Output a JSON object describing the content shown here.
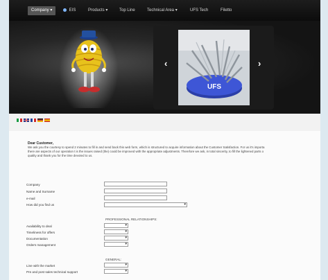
{
  "nav": {
    "items": [
      {
        "label": "Company",
        "caret": "▾",
        "active": true
      },
      {
        "label": "EIS",
        "active": false
      },
      {
        "label": "Products",
        "caret": "▾",
        "active": false
      },
      {
        "label": "Top Line",
        "active": false
      },
      {
        "label": "Technical Area",
        "caret": "▾",
        "active": false
      },
      {
        "label": "UFS Tech",
        "active": false
      },
      {
        "label": "Filetto",
        "active": false
      }
    ]
  },
  "slider": {
    "prev_glyph": "‹",
    "next_glyph": "›",
    "prev_icon": "chevron-left-icon",
    "next_icon": "chevron-right-icon"
  },
  "flags": [
    "italy-flag-icon",
    "uk-flag-icon",
    "france-flag-icon",
    "germany-flag-icon",
    "spain-flag-icon"
  ],
  "survey": {
    "greeting": "Dear Customer,",
    "intro_lines": [
      "We ask you the courtesy to spend 2 minutes to fill in and send back this web form, which is structured to acquire information about the Customer Satisfaction. For us it's importa",
      "there are aspects of our operation t is the issues raised (the) could be improved with the appropriate adjustments. Therefore we ask, in total sincerity, to fill the lightened parts o",
      "quality and thank you for the time devoted to us."
    ],
    "fields": [
      {
        "label": "Company",
        "value": ""
      },
      {
        "label": "Name and Surname",
        "value": ""
      },
      {
        "label": "e-mail",
        "value": ""
      }
    ],
    "how_found": {
      "label": "How did you find us",
      "value": ""
    },
    "professional_heading": "PROFESSIONAL RELATIONSHIPS:",
    "professional": [
      {
        "label": "Availability to deal",
        "value": ""
      },
      {
        "label": "Timeliness for offers",
        "value": ""
      },
      {
        "label": "Documentation",
        "value": ""
      },
      {
        "label": "Orders management",
        "value": ""
      }
    ],
    "general_heading": "GENERAL:",
    "general": [
      {
        "label": "Line with the market",
        "value": ""
      },
      {
        "label": "Pre and post sales technical support",
        "value": ""
      }
    ]
  }
}
